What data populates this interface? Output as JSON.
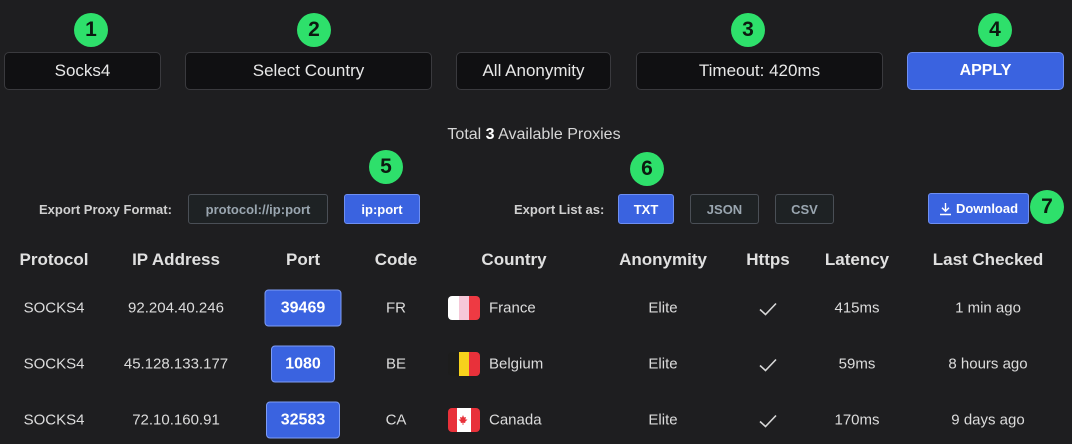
{
  "badges": [
    "1",
    "2",
    "3",
    "4",
    "5",
    "6",
    "7"
  ],
  "filters": {
    "protocol": "Socks4",
    "country": "Select Country",
    "anonymity": "All Anonymity",
    "timeout": "Timeout: 420ms",
    "apply": "APPLY"
  },
  "summary": {
    "prefix": "Total",
    "count": "3",
    "suffix": "Available Proxies"
  },
  "export": {
    "format_label": "Export Proxy Format:",
    "format_options": [
      "protocol://ip:port",
      "ip:port"
    ],
    "format_selected": "ip:port",
    "list_label": "Export List as:",
    "list_options": [
      "TXT",
      "JSON",
      "CSV"
    ],
    "list_selected": "TXT",
    "download_label": "Download"
  },
  "table": {
    "headers": [
      "Protocol",
      "IP Address",
      "Port",
      "Code",
      "Country",
      "Anonymity",
      "Https",
      "Latency",
      "Last Checked"
    ],
    "rows": [
      {
        "protocol": "SOCKS4",
        "ip": "92.204.40.246",
        "port": "39469",
        "code": "FR",
        "country": "France",
        "anonymity": "Elite",
        "https": true,
        "latency": "415ms",
        "last_checked": "1 min ago"
      },
      {
        "protocol": "SOCKS4",
        "ip": "45.128.133.177",
        "port": "1080",
        "code": "BE",
        "country": "Belgium",
        "anonymity": "Elite",
        "https": true,
        "latency": "59ms",
        "last_checked": "8 hours ago"
      },
      {
        "protocol": "SOCKS4",
        "ip": "72.10.160.91",
        "port": "32583",
        "code": "CA",
        "country": "Canada",
        "anonymity": "Elite",
        "https": true,
        "latency": "170ms",
        "last_checked": "9 days ago"
      }
    ]
  },
  "colors": {
    "accent": "#3a63e0",
    "badge": "#2ee06b",
    "background": "#1e1e20"
  },
  "icons": {
    "download": "download-arrow-icon",
    "https": "checkmark-icon"
  }
}
